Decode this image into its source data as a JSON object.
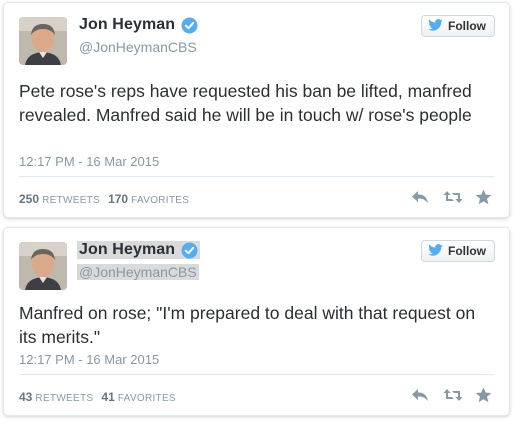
{
  "tweets": [
    {
      "author_name": "Jon Heyman",
      "handle": "@JonHeymanCBS",
      "follow_label": "Follow",
      "text": "Pete rose's reps have requested his ban be lifted, manfred revealed. Manfred said he will be in touch w/ rose's people",
      "timestamp": "12:17 PM - 16 Mar 2015",
      "retweets_count": "250",
      "retweets_label": "RETWEETS",
      "favorites_count": "170",
      "favorites_label": "FAVORITES"
    },
    {
      "author_name": "Jon Heyman",
      "handle": "@JonHeymanCBS",
      "follow_label": "Follow",
      "text": "Manfred on rose; \"I'm prepared to deal with that request on its merits.\"",
      "timestamp": "12:17 PM - 16 Mar 2015",
      "retweets_count": "43",
      "retweets_label": "RETWEETS",
      "favorites_count": "41",
      "favorites_label": "FAVORITES"
    }
  ],
  "icons": {
    "verified": "verified-badge-icon",
    "follow_bird": "twitter-bird-icon",
    "reply": "reply-icon",
    "retweet": "retweet-icon",
    "favorite": "star-icon"
  },
  "colors": {
    "verified_blue": "#55acee",
    "twitter_blue": "#55acee",
    "meta_gray": "#8899a6",
    "text": "#292f33",
    "action_gray": "#8899a6"
  }
}
